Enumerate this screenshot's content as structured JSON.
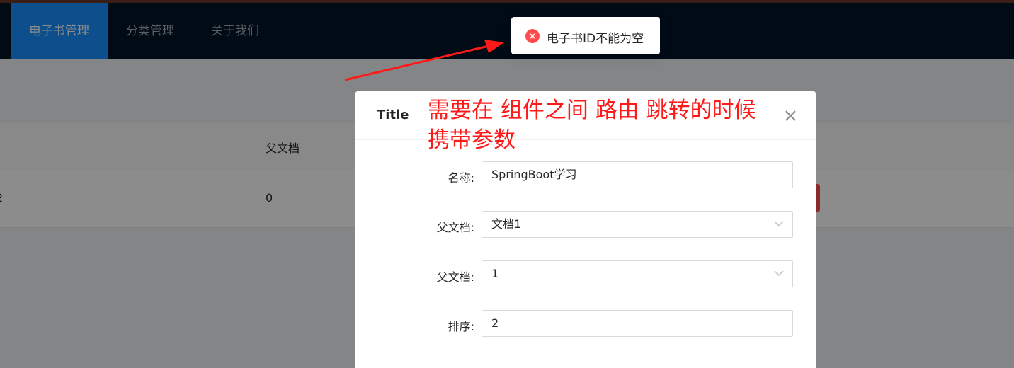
{
  "nav": {
    "items": [
      {
        "label": "电子书管理",
        "active": true
      },
      {
        "label": "分类管理",
        "active": false
      },
      {
        "label": "关于我们",
        "active": false
      }
    ]
  },
  "table": {
    "headers": {
      "parent_doc": "父文档"
    },
    "row": {
      "id_partial": "2",
      "parent_doc": "0"
    }
  },
  "modal": {
    "title": "Title",
    "fields": [
      {
        "label": "名称:",
        "value": "SpringBoot学习",
        "type": "input"
      },
      {
        "label": "父文档:",
        "value": "文档1",
        "type": "select"
      },
      {
        "label": "父文档:",
        "value": "1",
        "type": "select"
      },
      {
        "label": "排序:",
        "value": "2",
        "type": "input"
      }
    ]
  },
  "toast": {
    "message": "电子书ID不能为空",
    "type": "error",
    "icon": "close-circle-icon"
  },
  "annotation": {
    "text_line1": "需要在 组件之间 路由 跳转的时候",
    "text_line2": "携带参数",
    "color": "#ff1a1a"
  },
  "colors": {
    "header_bg": "#001529",
    "nav_active": "#1890ff",
    "error": "#ff4d4f"
  }
}
